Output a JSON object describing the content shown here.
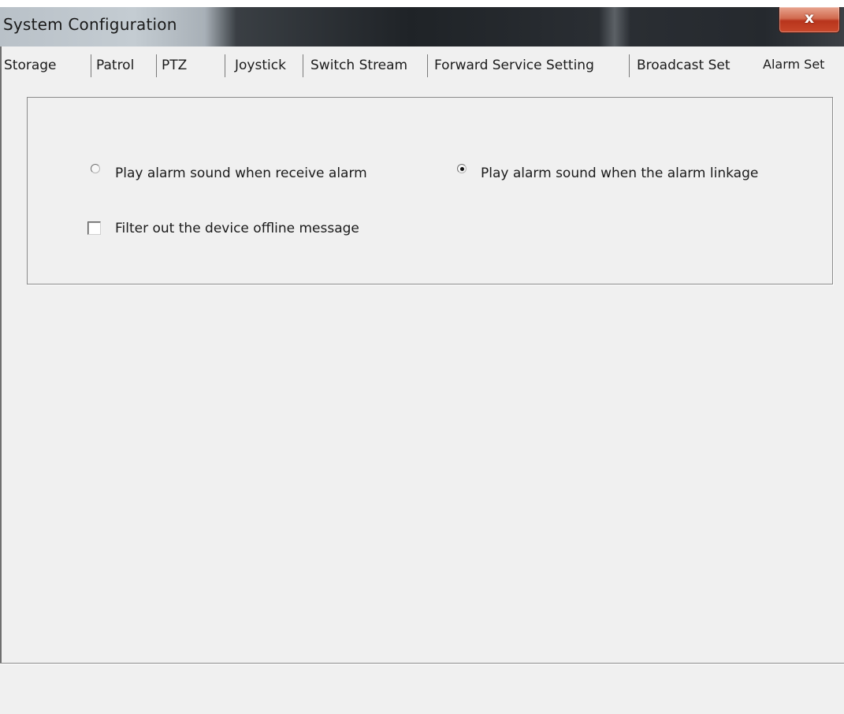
{
  "window": {
    "title": "System Configuration",
    "close_label": "x"
  },
  "tabs": [
    {
      "label": "Storage"
    },
    {
      "label": "Patrol"
    },
    {
      "label": "PTZ"
    },
    {
      "label": "Joystick"
    },
    {
      "label": "Switch Stream"
    },
    {
      "label": "Forward Service Setting"
    },
    {
      "label": "Broadcast Set"
    },
    {
      "label": "Alarm Set",
      "selected": true
    }
  ],
  "alarm_set": {
    "sound_mode_options": [
      {
        "label": "Play alarm sound when receive alarm",
        "checked": false
      },
      {
        "label": "Play alarm sound when the alarm linkage",
        "checked": true
      }
    ],
    "filter_offline": {
      "label": "Filter out the device offline message",
      "checked": false
    }
  },
  "colors": {
    "dialog_background": "#f0f0f0",
    "close_button": "#c8482b",
    "title_bar_dark": "#1f2327"
  }
}
